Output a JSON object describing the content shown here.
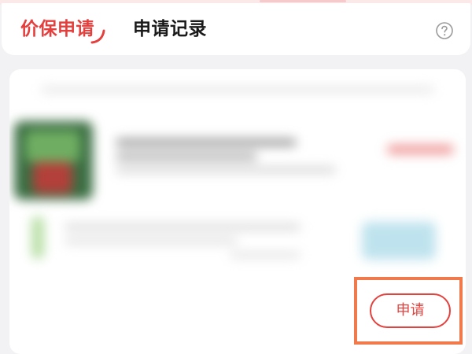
{
  "tabs": [
    {
      "label": "价保申请",
      "active": true
    },
    {
      "label": "申请记录",
      "active": false
    }
  ],
  "help_icon": "question-circle-icon",
  "apply_button": {
    "label": "申请"
  },
  "colors": {
    "accent": "#e43f3d",
    "highlight": "#f07a4c",
    "background": "#f2f2f4"
  }
}
